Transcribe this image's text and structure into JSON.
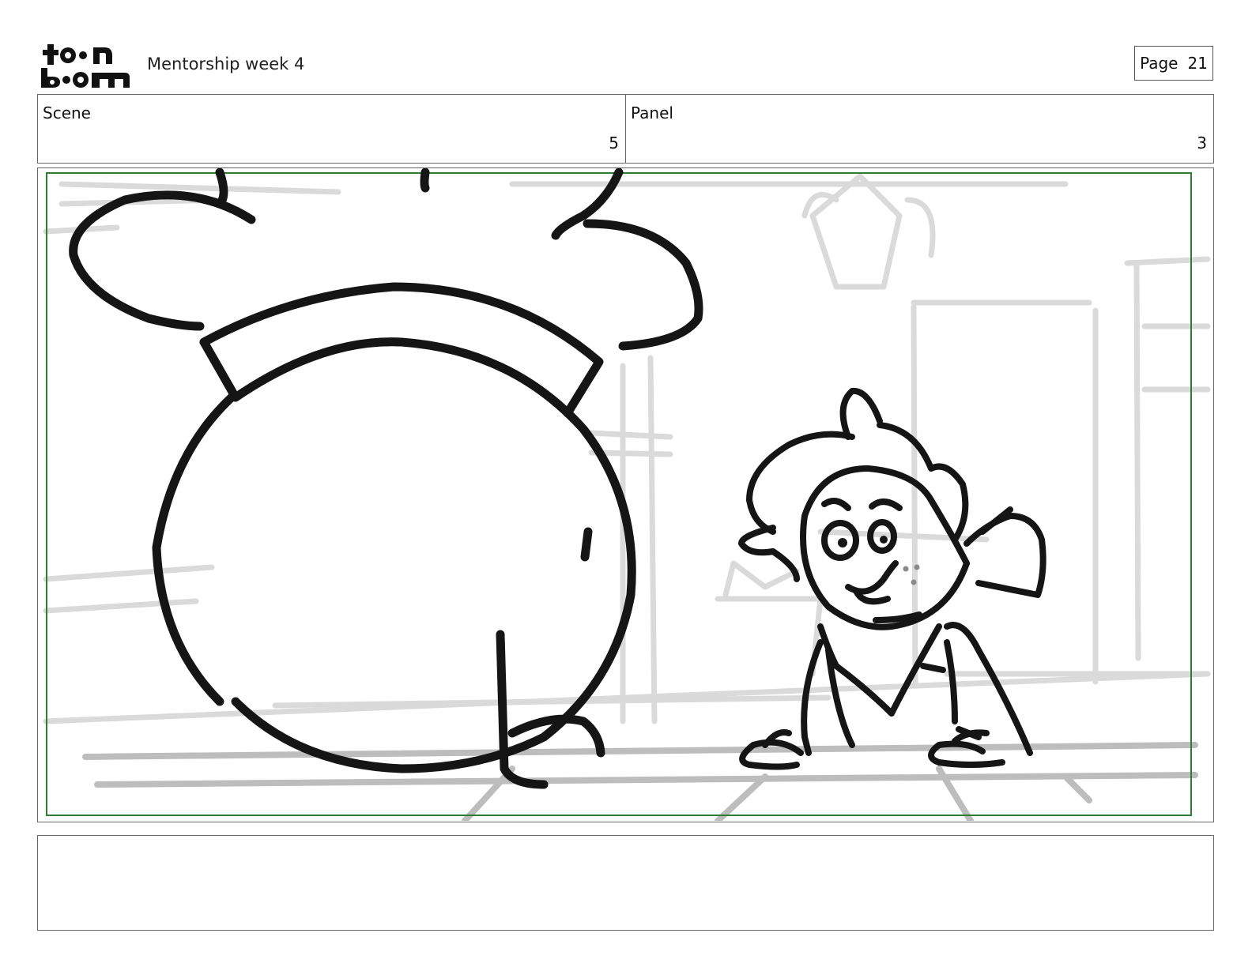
{
  "header": {
    "logo_text": "toon boom",
    "project_title": "Mentorship week 4",
    "page_label": "Page",
    "page_number": "21"
  },
  "info": {
    "scene_label": "Scene",
    "scene_value": "5",
    "panel_label": "Panel",
    "panel_value": "3"
  },
  "notes": {
    "text": ""
  },
  "colors": {
    "safe_frame": "#2e7d32",
    "ink": "#151515",
    "background_sketch": "#d9d9d9"
  }
}
